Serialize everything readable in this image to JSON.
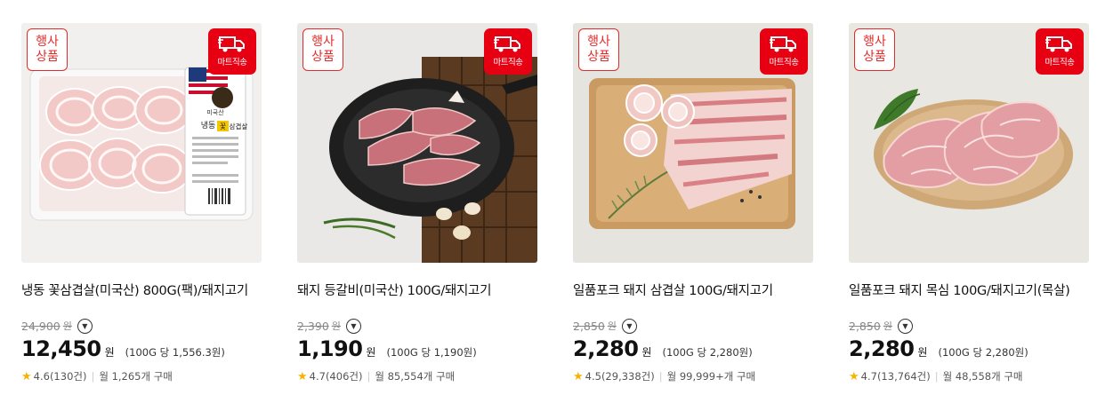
{
  "badges": {
    "event": [
      "행사",
      "상품"
    ],
    "shipping": "마트직송"
  },
  "products": [
    {
      "title": "냉동 꽃삼겹살(미국산) 800G(팩)/돼지고기",
      "original_price": "24,900",
      "won": "원",
      "price": "12,450",
      "unit_price": "(100G 당 1,556.3원)",
      "rating": "4.6(130건)",
      "sales": "월 1,265개 구매",
      "package_text": [
        "미국산",
        "냉동",
        "꽃",
        "삼겹살"
      ]
    },
    {
      "title": "돼지 등갈비(미국산) 100G/돼지고기",
      "original_price": "2,390",
      "won": "원",
      "price": "1,190",
      "unit_price": "(100G 당 1,190원)",
      "rating": "4.7(406건)",
      "sales": "월 85,554개 구매"
    },
    {
      "title": "일품포크 돼지 삼겹살 100G/돼지고기",
      "original_price": "2,850",
      "won": "원",
      "price": "2,280",
      "unit_price": "(100G 당 2,280원)",
      "rating": "4.5(29,338건)",
      "sales": "월 99,999+개 구매"
    },
    {
      "title": "일품포크 돼지 목심 100G/돼지고기(목살)",
      "original_price": "2,850",
      "won": "원",
      "price": "2,280",
      "unit_price": "(100G 당 2,280원)",
      "rating": "4.7(13,764건)",
      "sales": "월 48,558개 구매"
    }
  ],
  "icons": {
    "dropdown": "chevron-down-icon",
    "star": "star-icon",
    "truck": "truck-icon"
  },
  "colors": {
    "accent": "#e60012",
    "star": "#f6b400"
  }
}
